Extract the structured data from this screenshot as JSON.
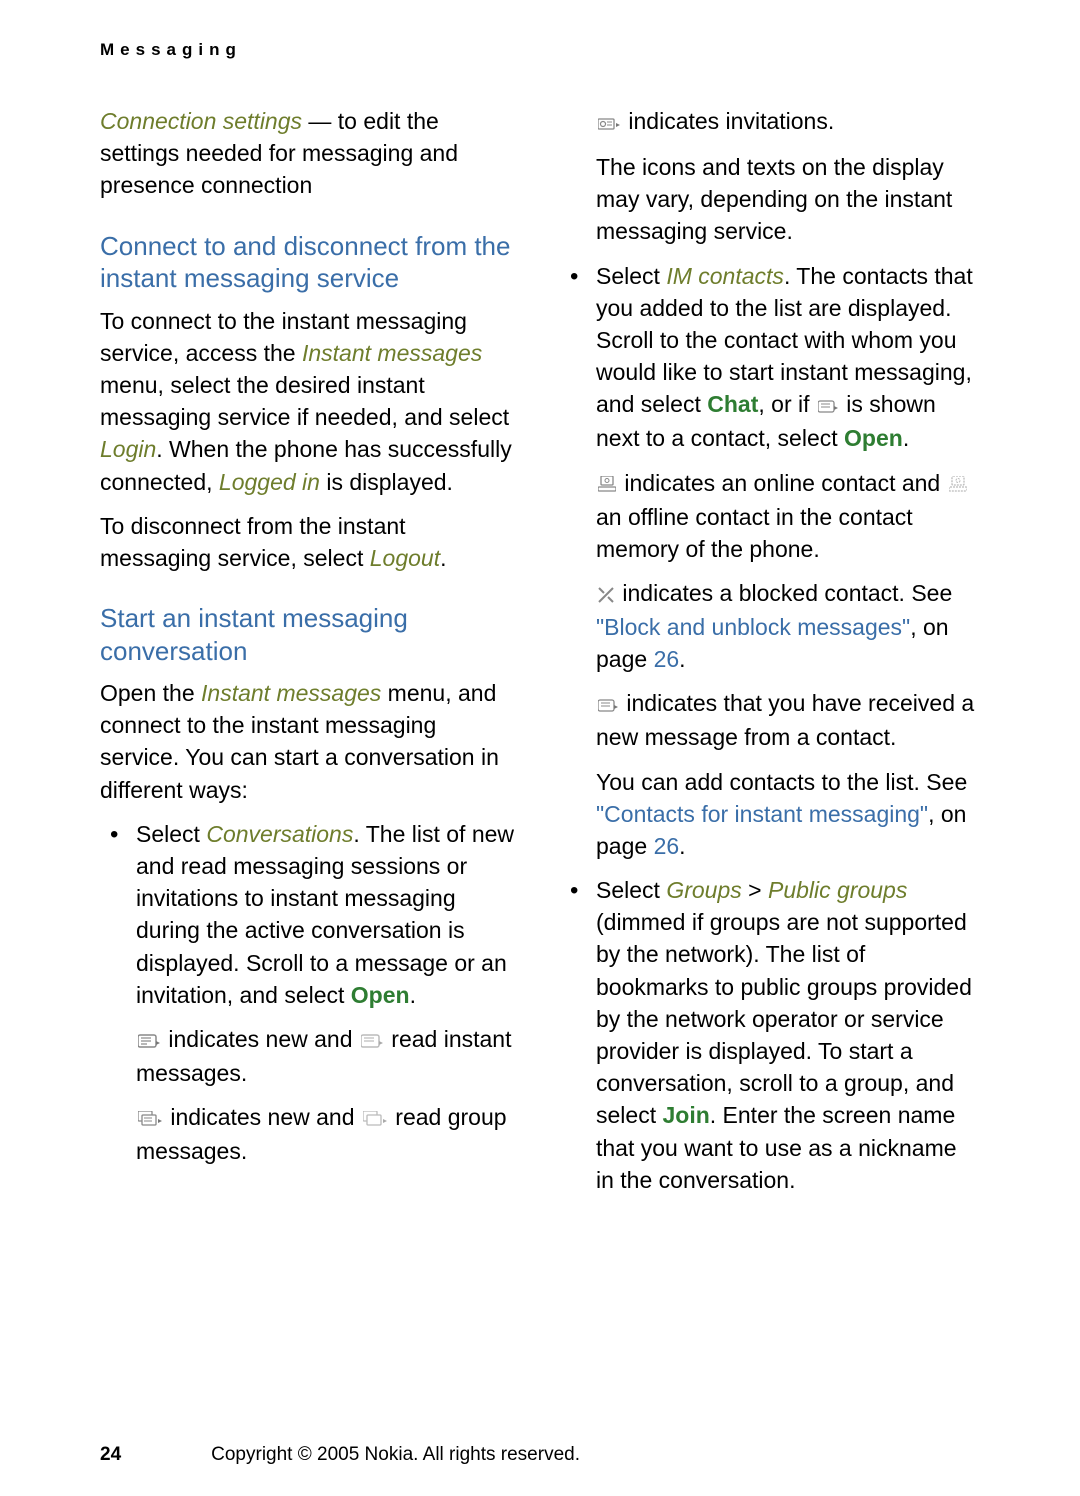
{
  "header": "Messaging",
  "left": {
    "p1_a": "Connection settings",
    "p1_b": " — to edit the settings needed for messaging and presence connection",
    "h1": "Connect to and disconnect from the instant messaging service",
    "p2_a": "To connect to the instant messaging service, access the ",
    "p2_b": "Instant messages",
    "p2_c": " menu, select the desired instant messaging service if needed, and select ",
    "p2_d": "Login",
    "p2_e": ". When the phone has successfully connected, ",
    "p2_f": "Logged in",
    "p2_g": " is displayed.",
    "p3_a": "To disconnect from the instant messaging service, select ",
    "p3_b": "Logout",
    "p3_c": ".",
    "h2": "Start an instant messaging conversation",
    "p4_a": "Open the ",
    "p4_b": "Instant messages",
    "p4_c": " menu, and connect to the instant messaging service. You can start a conversation in different ways:",
    "li1_a": "Select ",
    "li1_b": "Conversations",
    "li1_c": ". The list of new and read messaging sessions or invitations to instant messaging during the active conversation is displayed. Scroll to a message or an invitation, and select ",
    "li1_d": "Open",
    "li1_e": ".",
    "s1_a": " indicates new and ",
    "s1_b": " read instant messages.",
    "s2_a": " indicates new and ",
    "s2_b": " read group messages."
  },
  "right": {
    "s3": " indicates invitations.",
    "p5": "The icons and texts on the display may vary, depending on the instant messaging service.",
    "li2_a": "Select ",
    "li2_b": "IM contacts",
    "li2_c": ". The contacts that you added to the list are displayed. Scroll to the contact with whom you would like to start instant messaging, and select ",
    "li2_d": "Chat",
    "li2_e": ", or if ",
    "li2_f": " is shown next to a contact, select ",
    "li2_g": "Open",
    "li2_h": ".",
    "s4_a": " indicates an online contact and ",
    "s4_b": " an offline contact in the contact memory of the phone.",
    "s5_a": " indicates a blocked contact. See ",
    "s5_b": "\"Block and unblock messages\"",
    "s5_c": ", on page ",
    "s5_d": "26",
    "s5_e": ".",
    "s6": " indicates that you have received a new message from a contact.",
    "s7_a": "You can add contacts to the list. See ",
    "s7_b": "\"Contacts for instant messaging\"",
    "s7_c": ", on page ",
    "s7_d": "26",
    "s7_e": ".",
    "li3_a": "Select ",
    "li3_b": "Groups",
    "li3_c": " > ",
    "li3_d": "Public groups",
    "li3_e": " (dimmed if groups are not supported by the network). The list of bookmarks to public groups provided by the network operator or service provider is displayed. To start a conversation, scroll to a group, and select ",
    "li3_f": "Join",
    "li3_g": ". Enter the screen name that you want to use as a nickname in the conversation."
  },
  "footer": {
    "page": "24",
    "copyright": "Copyright © 2005 Nokia. All rights reserved."
  }
}
